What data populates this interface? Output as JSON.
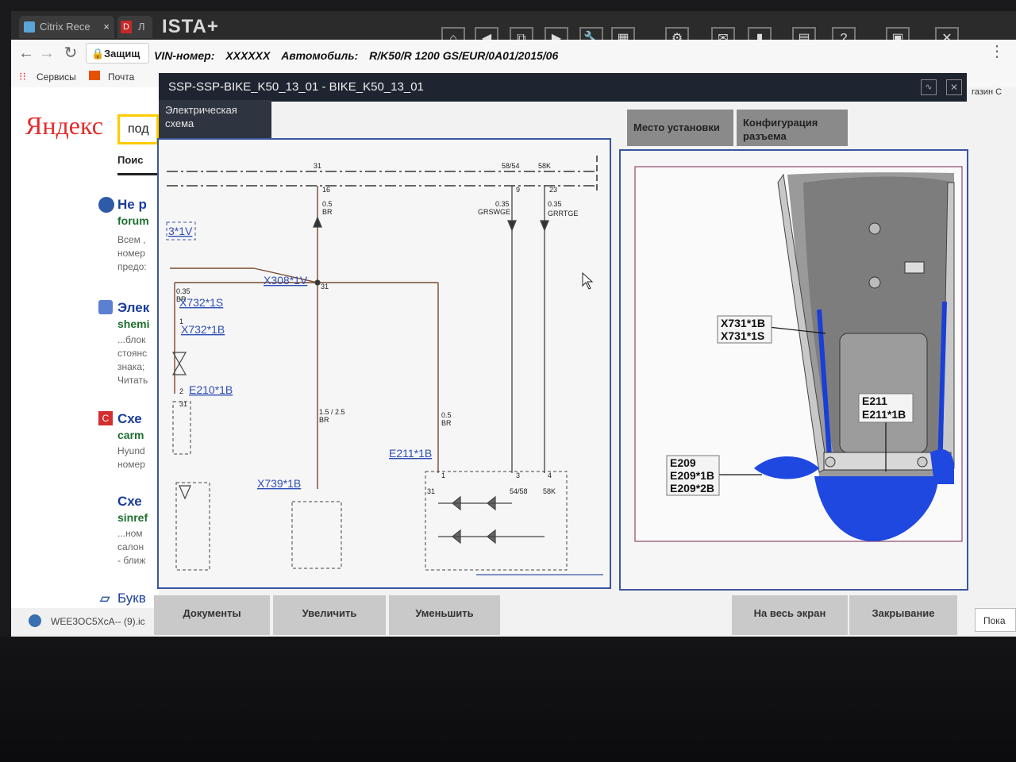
{
  "browser": {
    "tabs": [
      {
        "label": "Citrix Rece"
      },
      {
        "label": "Л"
      }
    ],
    "security_label": "Защищ",
    "bookmarks": [
      "Сервисы",
      "Почта"
    ]
  },
  "ista": {
    "app_title": "ISTA+",
    "vin_label": "VIN-номер:",
    "vin_value": "XXXXXX",
    "vehicle_label": "Автомобиль:",
    "vehicle_value": "R/K50/R 1200 GS/EUR/0A01/2015/06",
    "toolbar_icons": [
      "home-icon",
      "back-icon",
      "split-view-icon",
      "forward-icon",
      "wrench-icon",
      "grid-icon",
      "tools-icon",
      "mail-icon",
      "battery-icon",
      "print-icon",
      "help-icon",
      "notes-icon",
      "close-icon"
    ],
    "toolbar_glyphs": [
      "⌂",
      "◀",
      "⧉",
      "▶",
      "🔧",
      "▦",
      "⚙",
      "✉",
      "▮",
      "▤",
      "?",
      "▣",
      "✕"
    ],
    "document_title": "SSP-SSP-BIKE_K50_13_01  -  BIKE_K50_13_01",
    "right_hint": "газин С",
    "tabs": {
      "left": "Электрическая схема",
      "install": "Место установки",
      "connector": "Конфигурация разъема"
    },
    "diagram": {
      "pins": [
        "31",
        "16",
        "58/54",
        "9",
        "58K",
        "23",
        "31",
        "1",
        "2",
        "31",
        "1",
        "3",
        "4",
        "54/58",
        "58K",
        "31"
      ],
      "wire_labels": [
        "0.5",
        "BR",
        "0.35",
        "GRSWGE",
        "0.35",
        "GRRTGE",
        "0.35",
        "BR",
        "1.5 / 2.5",
        "BR",
        "0.5",
        "BR"
      ],
      "connectors": [
        "3*1V",
        "X308*1V",
        "X732*1S",
        "X732*1B",
        "E210*1B",
        "X739*1B",
        "E211*1B"
      ]
    },
    "image_labels": {
      "x731": [
        "X731*1B",
        "X731*1S"
      ],
      "e211": [
        "E211",
        "E211*1B"
      ],
      "e209": [
        "E209",
        "E209*1B",
        "E209*2B"
      ]
    },
    "buttons": {
      "documents": "Документы",
      "zoom_in": "Увеличить",
      "zoom_out": "Уменьшить",
      "fullscreen": "На весь экран",
      "close": "Закрывание",
      "right_cut": "Пока"
    }
  },
  "yandex": {
    "logo": "Яндекс",
    "search_btn": "под",
    "search_tab": "Поис",
    "results": [
      {
        "title": "Не р",
        "source": "forum",
        "lines": [
          "Всем ,",
          "номер",
          "предо:"
        ]
      },
      {
        "title": "Элек",
        "source": "shemi",
        "lines": [
          "...блок",
          "стоянс",
          "знака;",
          "Читать"
        ]
      },
      {
        "title": "Схе",
        "source": "carm",
        "lines": [
          "Hyund",
          "номер"
        ]
      },
      {
        "title": "Схе",
        "source": "sinref",
        "lines": [
          "...ном",
          "салон",
          "- ближ"
        ]
      },
      {
        "title": "Букв",
        "source": "",
        "lines": []
      }
    ],
    "download": "WEE3OC5XcA-- (9).ic"
  }
}
